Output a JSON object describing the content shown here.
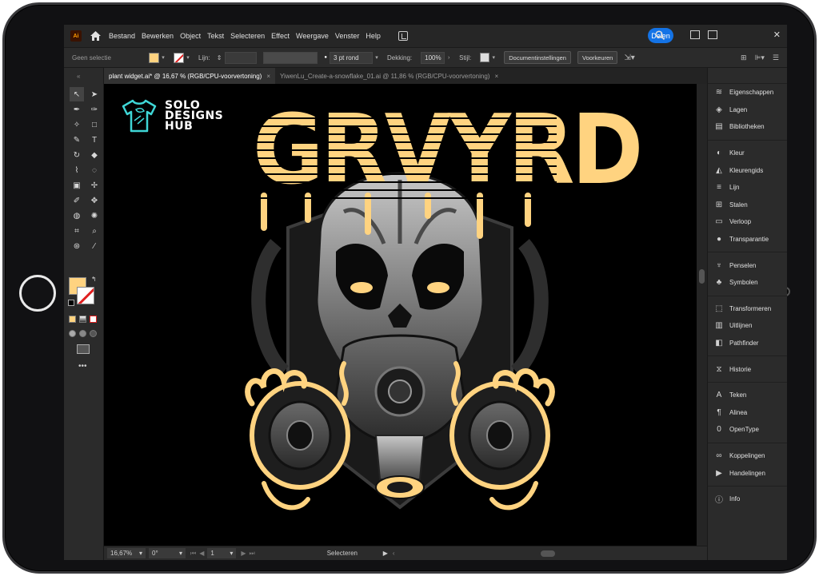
{
  "menubar": {
    "app_icon": "Ai",
    "items": [
      "Bestand",
      "Bewerken",
      "Object",
      "Tekst",
      "Selecteren",
      "Effect",
      "Weergave",
      "Venster",
      "Help"
    ],
    "share_label": "Delen"
  },
  "controlbar": {
    "selection_label": "Geen selectie",
    "stroke_label": "Lijn:",
    "brush_value": "3 pt rond",
    "opacity_label": "Dekking:",
    "opacity_value": "100%",
    "style_label": "Stijl:",
    "document_settings_label": "Documentinstellingen",
    "preferences_label": "Voorkeuren"
  },
  "tabs": [
    {
      "label": "plant widget.ai* @ 16,67 % (RGB/CPU-voorvertoning)",
      "active": true
    },
    {
      "label": "YiwenLu_Create-a-snowflake_01.ai @ 11,86 % (RGB/CPU-voorvertoning)",
      "active": false
    }
  ],
  "canvas": {
    "logo_line1": "SOLO",
    "logo_line2": "DESIGNS",
    "logo_line3": "HUB",
    "artwork_title": "GRVYRD"
  },
  "statusbar": {
    "zoom": "16,67%",
    "rotation": "0°",
    "artboard": "1",
    "tool_name": "Selecteren"
  },
  "panels": {
    "group1": [
      "Eigenschappen",
      "Lagen",
      "Bibliotheken"
    ],
    "group2": [
      "Kleur",
      "Kleurengids",
      "Lijn",
      "Stalen",
      "Verloop",
      "Transparantie"
    ],
    "group3": [
      "Penselen",
      "Symbolen"
    ],
    "group4": [
      "Transformeren",
      "Uitlijnen",
      "Pathfinder"
    ],
    "group5": [
      "Historie"
    ],
    "group6": [
      "Teken",
      "Alinea",
      "OpenType"
    ],
    "group7": [
      "Koppelingen",
      "Handelingen"
    ],
    "group8": [
      "Info"
    ]
  },
  "colors": {
    "fill": "#ffd380",
    "accent": "#1473e6",
    "canvas": "#000000"
  }
}
